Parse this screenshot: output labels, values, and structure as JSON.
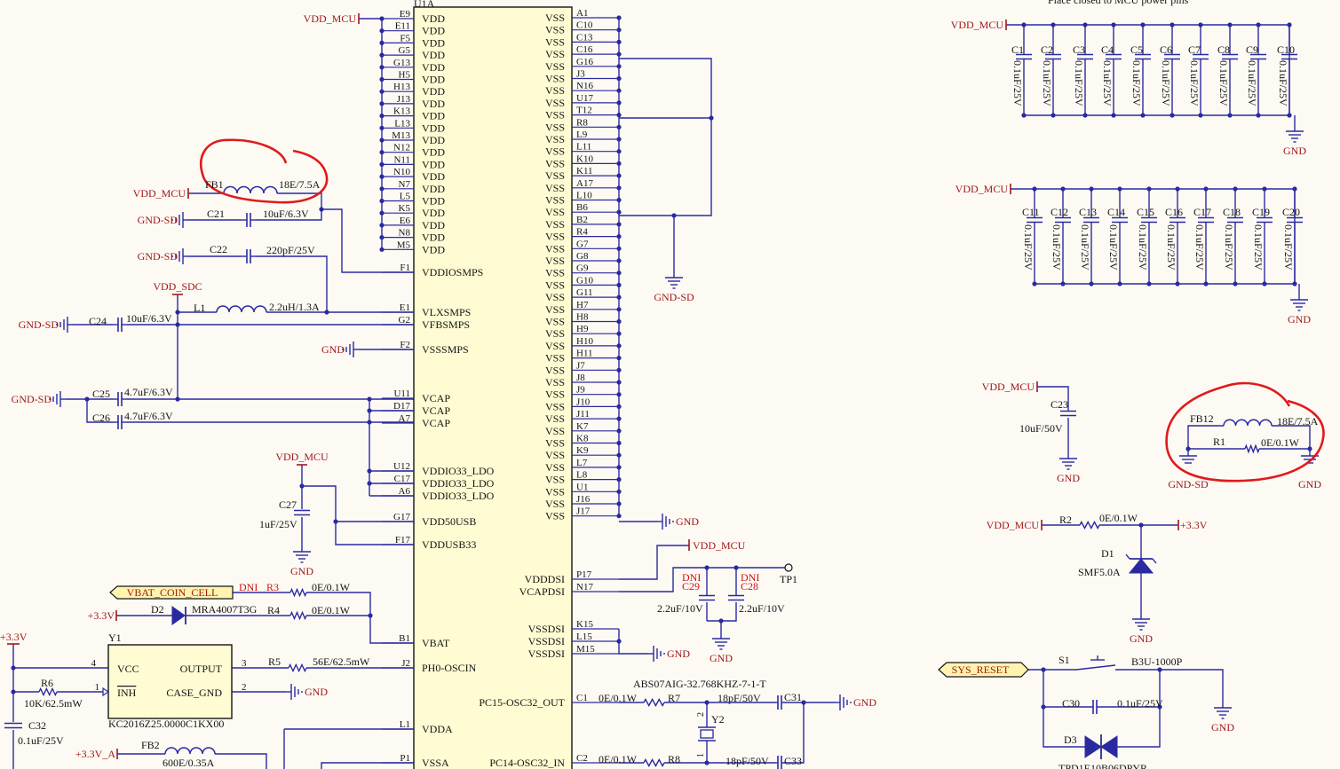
{
  "colors": {
    "wire": "#2a2aa0",
    "power": "#a01818",
    "dni": "#d01010",
    "ink": "#141414",
    "ic_fill": "#fffbd2",
    "ann": "#e01a1a",
    "tag_fill": "#fff3b0"
  },
  "ic": {
    "designator": "U1A",
    "left_pins": [
      {
        "num": "E9",
        "name": "VDD"
      },
      {
        "num": "E11",
        "name": "VDD"
      },
      {
        "num": "F5",
        "name": "VDD"
      },
      {
        "num": "G5",
        "name": "VDD"
      },
      {
        "num": "G13",
        "name": "VDD"
      },
      {
        "num": "H5",
        "name": "VDD"
      },
      {
        "num": "H13",
        "name": "VDD"
      },
      {
        "num": "J13",
        "name": "VDD"
      },
      {
        "num": "K13",
        "name": "VDD"
      },
      {
        "num": "L13",
        "name": "VDD"
      },
      {
        "num": "M13",
        "name": "VDD"
      },
      {
        "num": "N12",
        "name": "VDD"
      },
      {
        "num": "N11",
        "name": "VDD"
      },
      {
        "num": "N10",
        "name": "VDD"
      },
      {
        "num": "N7",
        "name": "VDD"
      },
      {
        "num": "L5",
        "name": "VDD"
      },
      {
        "num": "K5",
        "name": "VDD"
      },
      {
        "num": "E6",
        "name": "VDD"
      },
      {
        "num": "N8",
        "name": "VDD"
      },
      {
        "num": "M5",
        "name": "VDD"
      },
      {
        "num": "F1",
        "name": "VDDIOSMPS"
      },
      {
        "num": "E1",
        "name": "VLXSMPS"
      },
      {
        "num": "G2",
        "name": "VFBSMPS"
      },
      {
        "num": "F2",
        "name": "VSSSMPS"
      },
      {
        "num": "U11",
        "name": "VCAP"
      },
      {
        "num": "D17",
        "name": "VCAP"
      },
      {
        "num": "A7",
        "name": "VCAP"
      },
      {
        "num": "U12",
        "name": "VDDIO33_LDO"
      },
      {
        "num": "C17",
        "name": "VDDIO33_LDO"
      },
      {
        "num": "A6",
        "name": "VDDIO33_LDO"
      },
      {
        "num": "G17",
        "name": "VDD50USB"
      },
      {
        "num": "F17",
        "name": "VDDUSB33"
      },
      {
        "num": "B1",
        "name": "VBAT"
      },
      {
        "num": "J2",
        "name": "PH0-OSCIN"
      },
      {
        "num": "L1",
        "name": "VDDA"
      },
      {
        "num": "P1",
        "name": "VSSA"
      }
    ],
    "right_pins": [
      {
        "num": "A1",
        "name": "VSS"
      },
      {
        "num": "C10",
        "name": "VSS"
      },
      {
        "num": "C13",
        "name": "VSS"
      },
      {
        "num": "C16",
        "name": "VSS"
      },
      {
        "num": "G16",
        "name": "VSS"
      },
      {
        "num": "J3",
        "name": "VSS"
      },
      {
        "num": "N16",
        "name": "VSS"
      },
      {
        "num": "U17",
        "name": "VSS"
      },
      {
        "num": "T12",
        "name": "VSS"
      },
      {
        "num": "R8",
        "name": "VSS"
      },
      {
        "num": "L9",
        "name": "VSS"
      },
      {
        "num": "L11",
        "name": "VSS"
      },
      {
        "num": "K10",
        "name": "VSS"
      },
      {
        "num": "K11",
        "name": "VSS"
      },
      {
        "num": "A17",
        "name": "VSS"
      },
      {
        "num": "L10",
        "name": "VSS"
      },
      {
        "num": "B6",
        "name": "VSS"
      },
      {
        "num": "B2",
        "name": "VSS"
      },
      {
        "num": "R4",
        "name": "VSS"
      },
      {
        "num": "G7",
        "name": "VSS"
      },
      {
        "num": "G8",
        "name": "VSS"
      },
      {
        "num": "G9",
        "name": "VSS"
      },
      {
        "num": "G10",
        "name": "VSS"
      },
      {
        "num": "G11",
        "name": "VSS"
      },
      {
        "num": "H7",
        "name": "VSS"
      },
      {
        "num": "H8",
        "name": "VSS"
      },
      {
        "num": "H9",
        "name": "VSS"
      },
      {
        "num": "H10",
        "name": "VSS"
      },
      {
        "num": "H11",
        "name": "VSS"
      },
      {
        "num": "J7",
        "name": "VSS"
      },
      {
        "num": "J8",
        "name": "VSS"
      },
      {
        "num": "J9",
        "name": "VSS"
      },
      {
        "num": "J10",
        "name": "VSS"
      },
      {
        "num": "J11",
        "name": "VSS"
      },
      {
        "num": "K7",
        "name": "VSS"
      },
      {
        "num": "K8",
        "name": "VSS"
      },
      {
        "num": "K9",
        "name": "VSS"
      },
      {
        "num": "L7",
        "name": "VSS"
      },
      {
        "num": "L8",
        "name": "VSS"
      },
      {
        "num": "U1",
        "name": "VSS"
      },
      {
        "num": "J16",
        "name": "VSS"
      },
      {
        "num": "J17",
        "name": "VSS"
      },
      {
        "num": "P17",
        "name": "VDDDSI"
      },
      {
        "num": "N17",
        "name": "VCAPDSI"
      },
      {
        "num": "K15",
        "name": "VSSDSI"
      },
      {
        "num": "L15",
        "name": "VSSDSI"
      },
      {
        "num": "M15",
        "name": "VSSDSI"
      },
      {
        "num": "C1",
        "name": "PC15-OSC32_OUT"
      },
      {
        "num": "C2",
        "name": "PC14-OSC32_IN"
      }
    ]
  },
  "nets": {
    "vdd_mcu": "VDD_MCU",
    "gnd_sd": "GND-SD",
    "gnd": "GND",
    "vdd_sdc": "VDD_SDC",
    "p3v3": "+3.3V",
    "p3v3_a": "+3.3V_A",
    "tp1": "TP1"
  },
  "parts": {
    "fb1": {
      "ref": "FB1",
      "val": "18E/7.5A"
    },
    "c21": {
      "ref": "C21",
      "val": "10uF/6.3V"
    },
    "c22": {
      "ref": "C22",
      "val": "220pF/25V"
    },
    "l1": {
      "ref": "L1",
      "val": "2.2uH/1.3A"
    },
    "c24": {
      "ref": "C24",
      "val": "10uF/6.3V"
    },
    "c25": {
      "ref": "C25",
      "val": "4.7uF/6.3V"
    },
    "c26": {
      "ref": "C26",
      "val": "4.7uF/6.3V"
    },
    "c27": {
      "ref": "C27",
      "val": "1uF/25V"
    },
    "r3": {
      "ref": "R3",
      "val": "0E/0.1W",
      "dni": "DNI"
    },
    "d2": {
      "ref": "D2",
      "val": "MRA4007T3G"
    },
    "r4": {
      "ref": "R4",
      "val": "0E/0.1W"
    },
    "y1": {
      "ref": "Y1",
      "val": "KC2016Z25.0000C1KX00",
      "pin_vcc": "VCC",
      "pin_inh": "INH",
      "pin_out": "OUTPUT",
      "pin_case": "CASE_GND",
      "p4": "4",
      "p1": "1",
      "p3": "3",
      "p2": "2"
    },
    "r5": {
      "ref": "R5",
      "val": "56E/62.5mW"
    },
    "r6": {
      "ref": "R6",
      "val": "10K/62.5mW"
    },
    "c32": {
      "ref": "C32",
      "val": "0.1uF/25V"
    },
    "fb2": {
      "ref": "FB2",
      "val": "600E/0.35A"
    },
    "c29": {
      "ref": "C29",
      "val": "2.2uF/10V",
      "dni": "DNI"
    },
    "c28": {
      "ref": "C28",
      "val": "2.2uF/10V",
      "dni": "DNI"
    },
    "y2": {
      "ref": "Y2",
      "val": "ABS07AIG-32.768KHZ-7-1-T",
      "p1": "1",
      "p2": "2"
    },
    "r7": {
      "ref": "R7",
      "val": "0E/0.1W"
    },
    "c31": {
      "ref": "C31",
      "val": "18pF/50V"
    },
    "r8": {
      "ref": "R8",
      "val": "0E/0.1W"
    },
    "c33": {
      "ref": "C33",
      "val": "18pF/50V"
    },
    "c23": {
      "ref": "C23",
      "val": "10uF/50V"
    },
    "fb12": {
      "ref": "FB12",
      "val": "18E/7.5A"
    },
    "r1": {
      "ref": "R1",
      "val": "0E/0.1W"
    },
    "r2": {
      "ref": "R2",
      "val": "0E/0.1W"
    },
    "d1": {
      "ref": "D1",
      "val": "SMF5.0A"
    },
    "s1": {
      "ref": "S1",
      "val": "B3U-1000P"
    },
    "c30": {
      "ref": "C30",
      "val": "0.1uF/25V"
    },
    "d3": {
      "ref": "D3",
      "val": "TPD1E10B06DPYR"
    }
  },
  "decap_row1": {
    "refs": [
      "C1",
      "C2",
      "C3",
      "C4",
      "C5",
      "C6",
      "C7",
      "C8",
      "C9",
      "C10"
    ],
    "val": "0.1uF/25V",
    "note": "Place closed to MCU power pins"
  },
  "decap_row2": {
    "refs": [
      "C11",
      "C12",
      "C13",
      "C14",
      "C15",
      "C16",
      "C17",
      "C18",
      "C19",
      "C20"
    ],
    "val": "0.1uF/25V"
  },
  "tags": {
    "vbat_coin": "VBAT_COIN_CELL",
    "sys_reset": "SYS_RESET"
  }
}
